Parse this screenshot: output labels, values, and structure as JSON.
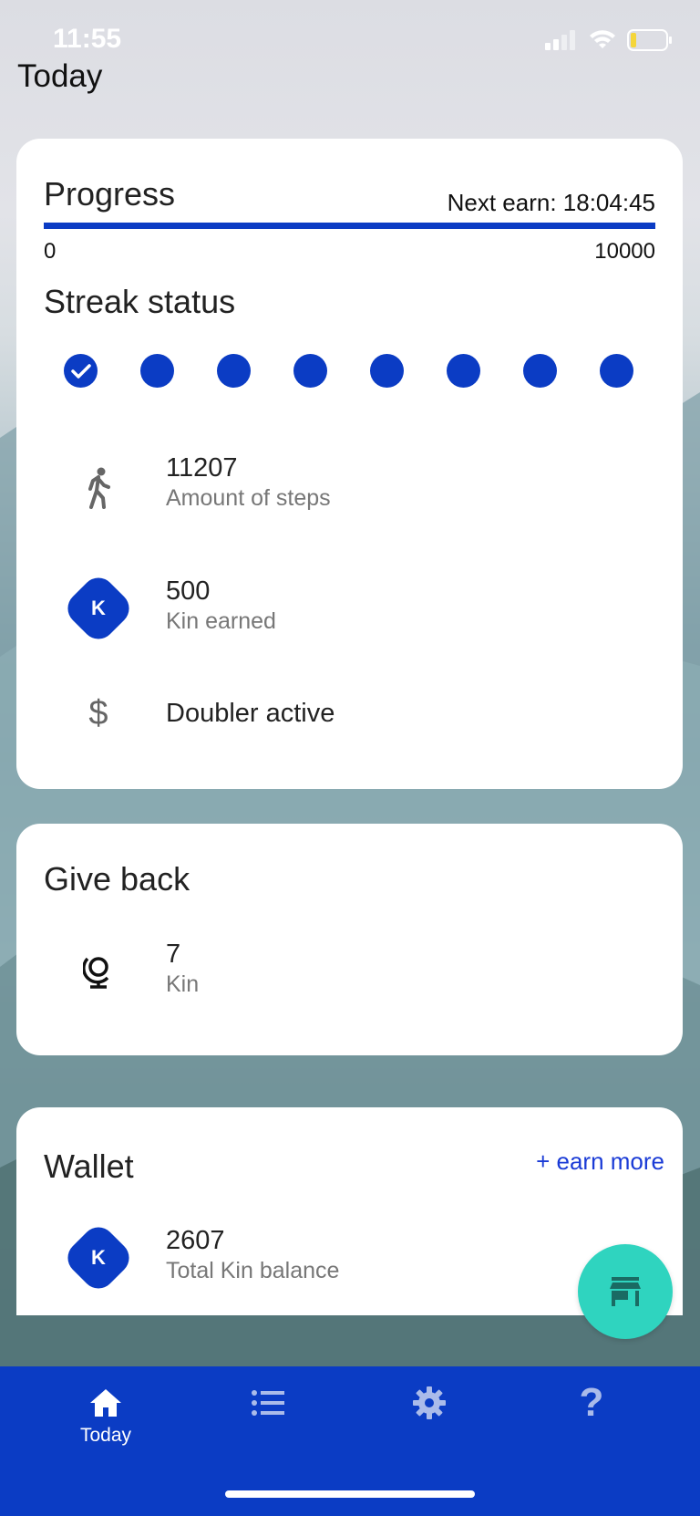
{
  "status_bar": {
    "time": "11:55"
  },
  "page": {
    "title": "Today"
  },
  "progress": {
    "title": "Progress",
    "next_earn": "Next earn: 18:04:45",
    "min": "0",
    "max": "10000",
    "fill_fraction": 1.0
  },
  "streak": {
    "title": "Streak status",
    "days": [
      true,
      false,
      false,
      false,
      false,
      false,
      false,
      false
    ]
  },
  "stats": {
    "steps": {
      "value": "11207",
      "label": "Amount of steps",
      "icon": "walking-icon"
    },
    "kin_earned": {
      "value": "500",
      "label": "Kin earned",
      "icon": "kin-icon"
    },
    "doubler": {
      "label": "Doubler active",
      "icon": "dollar-icon"
    }
  },
  "give_back": {
    "title": "Give back",
    "value": "7",
    "label": "Kin",
    "icon": "globe-icon"
  },
  "wallet": {
    "title": "Wallet",
    "earn_more": "+ earn more",
    "value": "2607",
    "label": "Total Kin balance",
    "icon": "kin-icon"
  },
  "kin_symbol": "K",
  "tabs": [
    {
      "label": "Today",
      "icon": "home-icon",
      "active": true
    },
    {
      "label": "",
      "icon": "list-icon",
      "active": false
    },
    {
      "label": "",
      "icon": "gear-icon",
      "active": false
    },
    {
      "label": "",
      "icon": "help-icon",
      "active": false
    }
  ],
  "colors": {
    "primary": "#0b3cc4",
    "fab": "#2fd4bf",
    "link": "#1a3bd6"
  }
}
